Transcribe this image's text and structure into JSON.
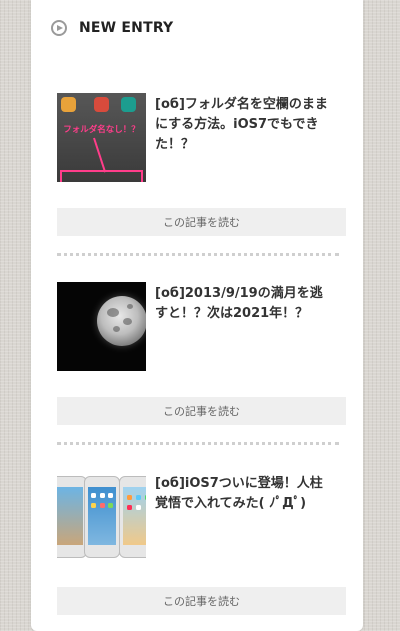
{
  "header": {
    "title": "NEW ENTRY",
    "icon": "play-circle-icon"
  },
  "entries": [
    {
      "title": "[об]フォルダ名を空欄のままにする方法。iOS7でもできた！？",
      "button": "この記事を読む",
      "thumb_caption": "フォルダ名なし！？"
    },
    {
      "title": "[об]2013/9/19の満月を逃すと！？次は2021年！？",
      "button": "この記事を読む"
    },
    {
      "title": "[об]iOS7ついに登場！人柱覚悟で入れてみた( ﾉﾟДﾟ)",
      "button": "この記事を読む"
    }
  ],
  "colors": {
    "accent_pink": "#ff3d8a",
    "button_bg": "#efefef"
  }
}
